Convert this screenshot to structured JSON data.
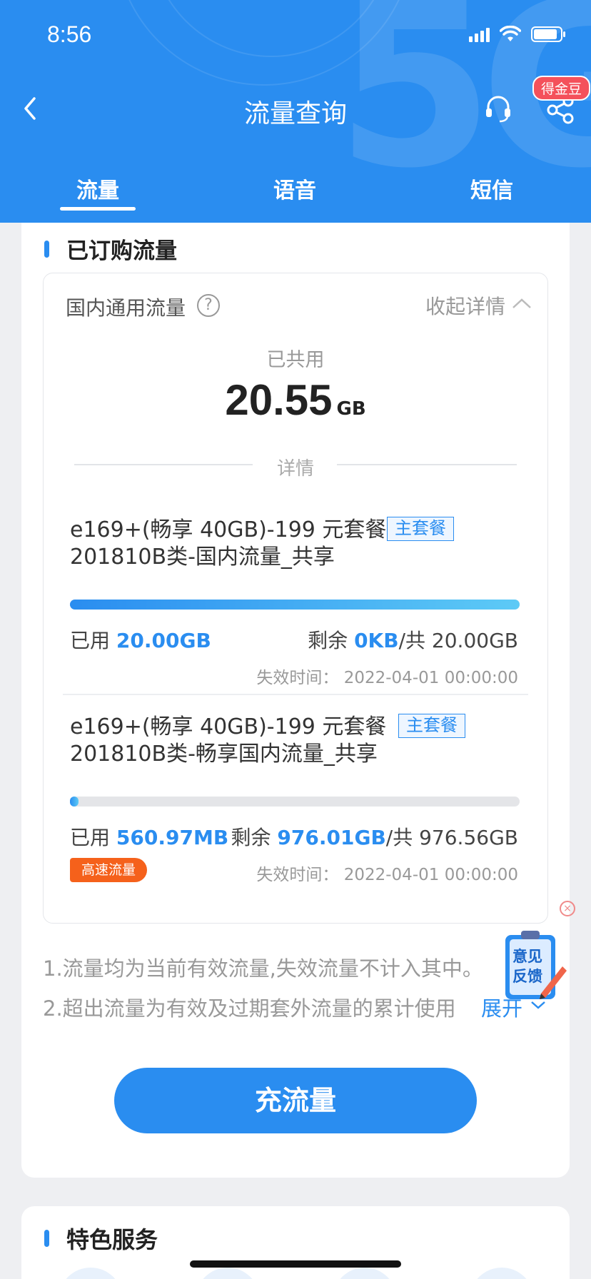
{
  "status_bar": {
    "time": "8:56"
  },
  "header": {
    "title": "流量查询",
    "badge": "得金豆",
    "tabs": [
      "流量",
      "语音",
      "短信"
    ],
    "active_tab": "流量"
  },
  "section": {
    "title": "已订购流量"
  },
  "domestic": {
    "label": "国内通用流量",
    "help": "?",
    "collapse": "收起详情",
    "used_label": "已共用",
    "used_value": "20.55",
    "used_unit": "GB",
    "detail_label": "详情"
  },
  "packages": [
    {
      "name_line1": "e169+(畅享 40GB)-199 元套餐",
      "name_line2": "201810B类-国内流量_共享",
      "tag": "主套餐",
      "used_prefix": "已用 ",
      "used": "20.00GB",
      "remain_prefix": "剩余 ",
      "remain": "0KB",
      "total": "/共 20.00GB",
      "progress": 1.0,
      "expire": "失效时间：  2022-04-01 00:00:00"
    },
    {
      "name_line1": "e169+(畅享 40GB)-199 元套餐",
      "name_line2": "201810B类-畅享国内流量_共享",
      "tag": "主套餐",
      "used_prefix": "已用 ",
      "used": "560.97MB",
      "remain_prefix": "剩余 ",
      "remain": "976.01GB",
      "total": "/共 976.56GB",
      "progress": 0.006,
      "badge": "高速流量",
      "expire": "失效时间：  2022-04-01 00:00:00"
    }
  ],
  "notes": [
    "1.流量均为当前有效流量,失效流量不计入其中。",
    "2.超出流量为有效及过期套外流量的累计使用"
  ],
  "expand": "展开",
  "feedback": {
    "line1": "意见",
    "line2": "反馈"
  },
  "cta": "充流量",
  "section2": {
    "title": "特色服务"
  },
  "colors": {
    "primary": "#2a8df0",
    "badge_orange": "#f5611b",
    "badge_red": "#f4515b"
  }
}
